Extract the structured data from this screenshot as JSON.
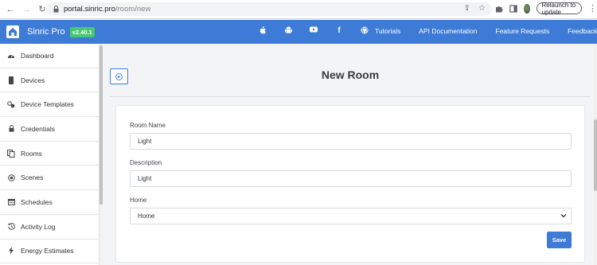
{
  "browser": {
    "url_host": "portal.sinric.pro",
    "url_path": "/room/new",
    "relaunch_label": "Relaunch to update"
  },
  "header": {
    "brand": "Sinric Pro",
    "version": "v2.40.1",
    "social_icons": [
      "apple-icon",
      "android-icon",
      "youtube-icon",
      "facebook-icon",
      "github-icon"
    ],
    "nav": [
      "Tutorials",
      "API Documentation",
      "Feature Requests",
      "Feedback"
    ],
    "accent_color": "#3d7bd6",
    "version_badge_color": "#48c774"
  },
  "sidebar": {
    "items": [
      {
        "label": "Dashboard",
        "icon": "dashboard-icon"
      },
      {
        "label": "Devices",
        "icon": "device-icon"
      },
      {
        "label": "Device Templates",
        "icon": "templates-icon"
      },
      {
        "label": "Credentials",
        "icon": "lock-icon"
      },
      {
        "label": "Rooms",
        "icon": "rooms-icon"
      },
      {
        "label": "Scenes",
        "icon": "scenes-icon"
      },
      {
        "label": "Schedules",
        "icon": "calendar-icon"
      },
      {
        "label": "Activity Log",
        "icon": "history-icon"
      },
      {
        "label": "Energy Estimates",
        "icon": "bolt-icon"
      }
    ]
  },
  "main": {
    "title": "New Room",
    "form": {
      "room_name_label": "Room Name",
      "room_name_value": "Light",
      "description_label": "Description",
      "description_value": "Light",
      "home_label": "Home",
      "home_selected": "Home",
      "save_label": "Save"
    }
  }
}
